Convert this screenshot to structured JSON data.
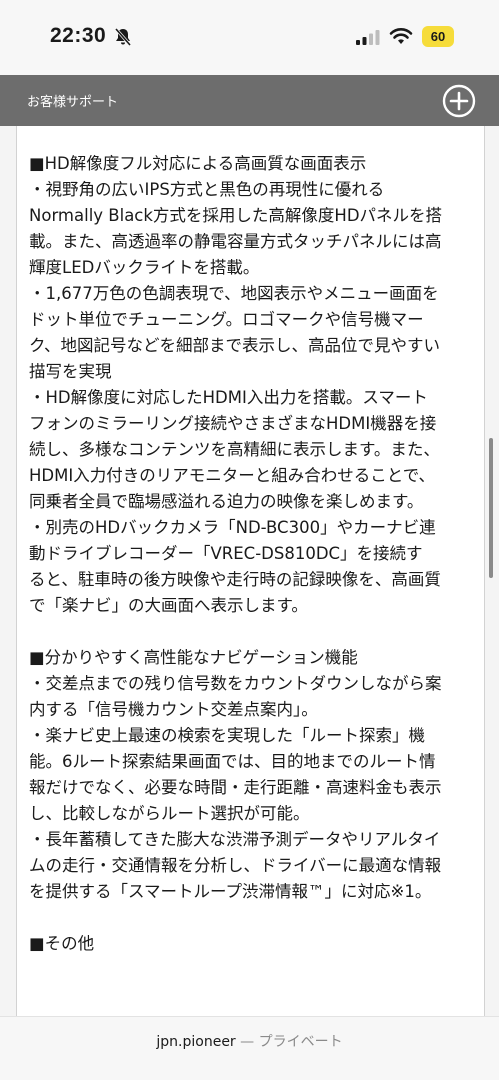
{
  "status_bar": {
    "time": "22:30",
    "battery_level": "60",
    "battery_color": "#f6dc3a"
  },
  "nav": {
    "title": "お客様サポート"
  },
  "article": {
    "lines": [
      "■HD解像度フル対応による高画質な画面表示",
      "・視野角の広いIPS方式と黒色の再現性に優れる",
      "Normally Black方式を採用した高解像度HDパネルを搭",
      "載。また、高透過率の静電容量方式タッチパネルには高",
      "輝度LEDバックライトを搭載。",
      "・1,677万色の色調表現で、地図表示やメニュー画面を",
      "ドット単位でチューニング。ロゴマークや信号機マー",
      "ク、地図記号などを細部まで表示し、高品位で見やすい",
      "描写を実現",
      "・HD解像度に対応したHDMI入出力を搭載。スマート",
      "フォンのミラーリング接続やさまざまなHDMI機器を接",
      "続し、多様なコンテンツを高精細に表示します。また、",
      "HDMI入力付きのリアモニターと組み合わせることで、",
      "同乗者全員で臨場感溢れる迫力の映像を楽しめます。",
      "・別売のHDバックカメラ「ND-BC300」やカーナビ連",
      "動ドライブレコーダー「VREC-DS810DC」を接続す",
      "ると、駐車時の後方映像や走行時の記録映像を、高画質",
      "で「楽ナビ」の大画面へ表示します。",
      "",
      "■分かりやすく高性能なナビゲーション機能",
      "・交差点までの残り信号数をカウントダウンしながら案",
      "内する「信号機カウント交差点案内」。",
      "・楽ナビ史上最速の検索を実現した「ルート探索」機",
      "能。6ルート探索結果画面では、目的地までのルート情",
      "報だけでなく、必要な時間・走行距離・高速料金も表示",
      "し、比較しながらルート選択が可能。",
      "・長年蓄積してきた膨大な渋滞予測データやリアルタイ",
      "ムの走行・交通情報を分析し、ドライバーに最適な情報",
      "を提供する「スマートループ渋滞情報™」に対応※1。",
      "",
      "■その他"
    ]
  },
  "url_bar": {
    "domain": "jpn.pioneer",
    "separator": " — ",
    "mode": "プライベート"
  }
}
